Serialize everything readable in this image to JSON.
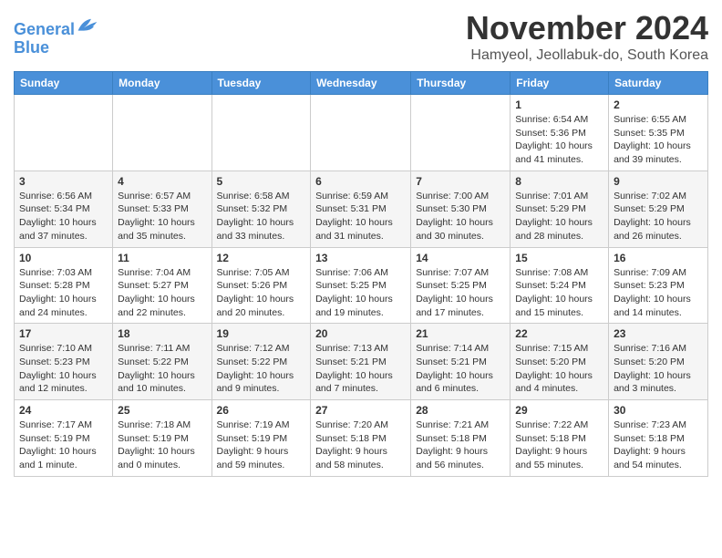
{
  "logo": {
    "line1": "General",
    "line2": "Blue"
  },
  "title": "November 2024",
  "subtitle": "Hamyeol, Jeollabuk-do, South Korea",
  "weekdays": [
    "Sunday",
    "Monday",
    "Tuesday",
    "Wednesday",
    "Thursday",
    "Friday",
    "Saturday"
  ],
  "weeks": [
    [
      {
        "day": "",
        "info": ""
      },
      {
        "day": "",
        "info": ""
      },
      {
        "day": "",
        "info": ""
      },
      {
        "day": "",
        "info": ""
      },
      {
        "day": "",
        "info": ""
      },
      {
        "day": "1",
        "info": "Sunrise: 6:54 AM\nSunset: 5:36 PM\nDaylight: 10 hours and 41 minutes."
      },
      {
        "day": "2",
        "info": "Sunrise: 6:55 AM\nSunset: 5:35 PM\nDaylight: 10 hours and 39 minutes."
      }
    ],
    [
      {
        "day": "3",
        "info": "Sunrise: 6:56 AM\nSunset: 5:34 PM\nDaylight: 10 hours and 37 minutes."
      },
      {
        "day": "4",
        "info": "Sunrise: 6:57 AM\nSunset: 5:33 PM\nDaylight: 10 hours and 35 minutes."
      },
      {
        "day": "5",
        "info": "Sunrise: 6:58 AM\nSunset: 5:32 PM\nDaylight: 10 hours and 33 minutes."
      },
      {
        "day": "6",
        "info": "Sunrise: 6:59 AM\nSunset: 5:31 PM\nDaylight: 10 hours and 31 minutes."
      },
      {
        "day": "7",
        "info": "Sunrise: 7:00 AM\nSunset: 5:30 PM\nDaylight: 10 hours and 30 minutes."
      },
      {
        "day": "8",
        "info": "Sunrise: 7:01 AM\nSunset: 5:29 PM\nDaylight: 10 hours and 28 minutes."
      },
      {
        "day": "9",
        "info": "Sunrise: 7:02 AM\nSunset: 5:29 PM\nDaylight: 10 hours and 26 minutes."
      }
    ],
    [
      {
        "day": "10",
        "info": "Sunrise: 7:03 AM\nSunset: 5:28 PM\nDaylight: 10 hours and 24 minutes."
      },
      {
        "day": "11",
        "info": "Sunrise: 7:04 AM\nSunset: 5:27 PM\nDaylight: 10 hours and 22 minutes."
      },
      {
        "day": "12",
        "info": "Sunrise: 7:05 AM\nSunset: 5:26 PM\nDaylight: 10 hours and 20 minutes."
      },
      {
        "day": "13",
        "info": "Sunrise: 7:06 AM\nSunset: 5:25 PM\nDaylight: 10 hours and 19 minutes."
      },
      {
        "day": "14",
        "info": "Sunrise: 7:07 AM\nSunset: 5:25 PM\nDaylight: 10 hours and 17 minutes."
      },
      {
        "day": "15",
        "info": "Sunrise: 7:08 AM\nSunset: 5:24 PM\nDaylight: 10 hours and 15 minutes."
      },
      {
        "day": "16",
        "info": "Sunrise: 7:09 AM\nSunset: 5:23 PM\nDaylight: 10 hours and 14 minutes."
      }
    ],
    [
      {
        "day": "17",
        "info": "Sunrise: 7:10 AM\nSunset: 5:23 PM\nDaylight: 10 hours and 12 minutes."
      },
      {
        "day": "18",
        "info": "Sunrise: 7:11 AM\nSunset: 5:22 PM\nDaylight: 10 hours and 10 minutes."
      },
      {
        "day": "19",
        "info": "Sunrise: 7:12 AM\nSunset: 5:22 PM\nDaylight: 10 hours and 9 minutes."
      },
      {
        "day": "20",
        "info": "Sunrise: 7:13 AM\nSunset: 5:21 PM\nDaylight: 10 hours and 7 minutes."
      },
      {
        "day": "21",
        "info": "Sunrise: 7:14 AM\nSunset: 5:21 PM\nDaylight: 10 hours and 6 minutes."
      },
      {
        "day": "22",
        "info": "Sunrise: 7:15 AM\nSunset: 5:20 PM\nDaylight: 10 hours and 4 minutes."
      },
      {
        "day": "23",
        "info": "Sunrise: 7:16 AM\nSunset: 5:20 PM\nDaylight: 10 hours and 3 minutes."
      }
    ],
    [
      {
        "day": "24",
        "info": "Sunrise: 7:17 AM\nSunset: 5:19 PM\nDaylight: 10 hours and 1 minute."
      },
      {
        "day": "25",
        "info": "Sunrise: 7:18 AM\nSunset: 5:19 PM\nDaylight: 10 hours and 0 minutes."
      },
      {
        "day": "26",
        "info": "Sunrise: 7:19 AM\nSunset: 5:19 PM\nDaylight: 9 hours and 59 minutes."
      },
      {
        "day": "27",
        "info": "Sunrise: 7:20 AM\nSunset: 5:18 PM\nDaylight: 9 hours and 58 minutes."
      },
      {
        "day": "28",
        "info": "Sunrise: 7:21 AM\nSunset: 5:18 PM\nDaylight: 9 hours and 56 minutes."
      },
      {
        "day": "29",
        "info": "Sunrise: 7:22 AM\nSunset: 5:18 PM\nDaylight: 9 hours and 55 minutes."
      },
      {
        "day": "30",
        "info": "Sunrise: 7:23 AM\nSunset: 5:18 PM\nDaylight: 9 hours and 54 minutes."
      }
    ]
  ]
}
